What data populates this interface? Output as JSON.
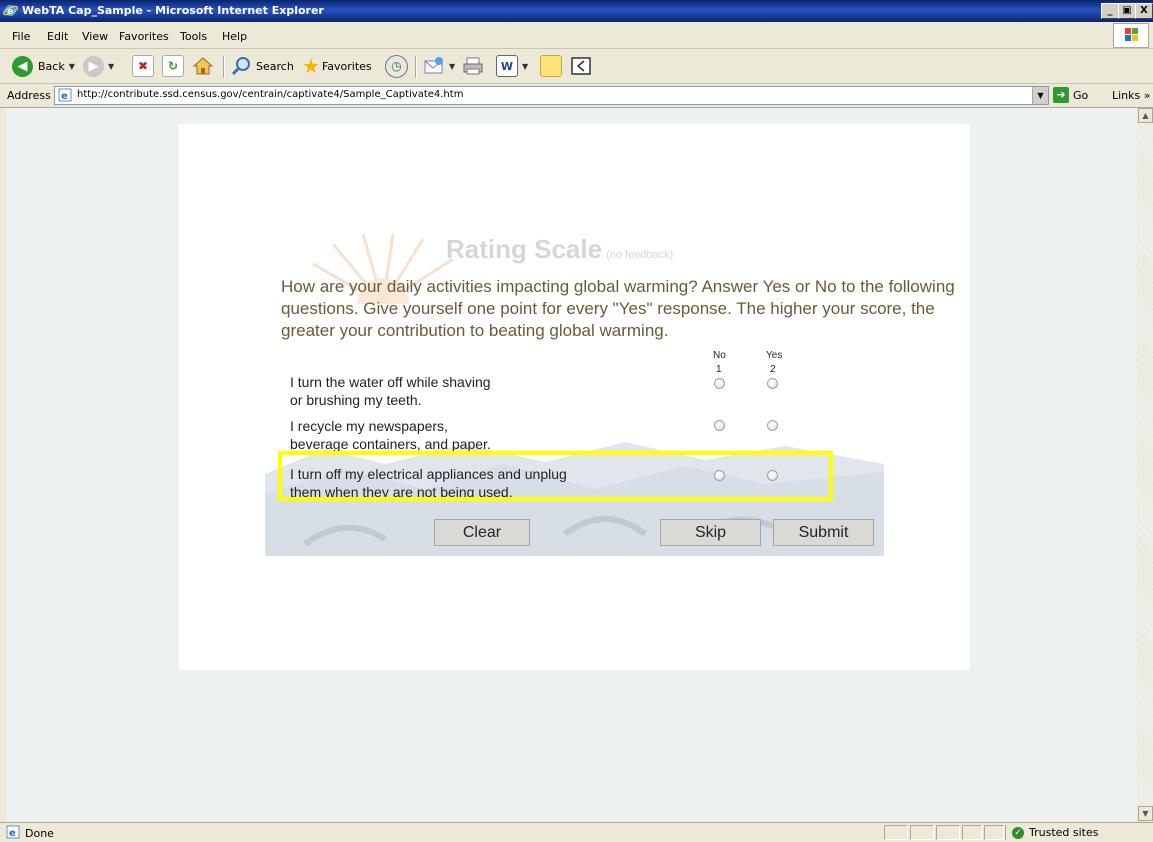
{
  "window": {
    "title": "WebTA Cap_Sample - Microsoft Internet Explorer",
    "minimize": "_",
    "maximize": "▣",
    "close": "X"
  },
  "menu": [
    "File",
    "Edit",
    "View",
    "Favorites",
    "Tools",
    "Help"
  ],
  "toolbar": {
    "back": "Back",
    "search": "Search",
    "favorites": "Favorites",
    "word_icon": "W"
  },
  "address": {
    "label": "Address",
    "url": "http://contribute.ssd.census.gov/centrain/captivate4/Sample_Captivate4.htm",
    "go": "Go",
    "links": "Links",
    "links_chevron": "»"
  },
  "quiz": {
    "title": "Rating Scale",
    "subtitle": "(no feedback)",
    "question": "How are your daily activities impacting global warming? Answer Yes or No to the following questions. Give yourself one point for every \"Yes\" response. The higher your score, the greater your contribution to beating global warming.",
    "columns": [
      {
        "label": "No",
        "value": "1"
      },
      {
        "label": "Yes",
        "value": "2"
      }
    ],
    "statements": [
      {
        "line1": "I turn the water off while shaving",
        "line2": "or brushing my teeth."
      },
      {
        "line1": "I recycle my newspapers,",
        "line2": "beverage containers, and paper."
      },
      {
        "line1": "I turn off my electrical appliances and unplug",
        "line2": "them when they are not being used."
      }
    ],
    "buttons": {
      "clear": "Clear",
      "skip": "Skip",
      "submit": "Submit"
    },
    "highlight_color": "#ffff00",
    "question_color": "#6b5a3a"
  },
  "status": {
    "text": "Done",
    "zone": "Trusted sites"
  }
}
